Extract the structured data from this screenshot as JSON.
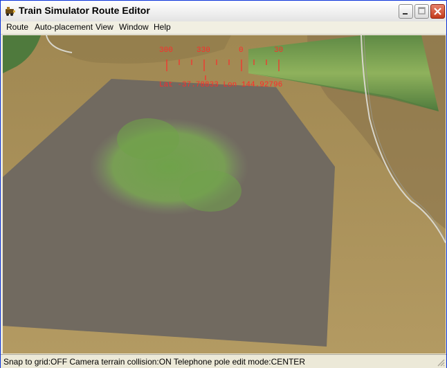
{
  "window": {
    "title": "Train Simulator Route Editor"
  },
  "menu": {
    "items": [
      {
        "label": "Route",
        "mnemonic": "R"
      },
      {
        "label": "Auto-placement",
        "mnemonic": "A"
      },
      {
        "label": "View",
        "mnemonic": "V"
      },
      {
        "label": "Window",
        "mnemonic": "W"
      },
      {
        "label": "Help",
        "mnemonic": "H"
      }
    ]
  },
  "compass": {
    "labels": [
      "300",
      "330",
      "0",
      "30"
    ],
    "coords": "Lat -37.78833 Lon 144.92796",
    "color": "#ff2a2a"
  },
  "status": {
    "text": "Snap to grid:OFF Camera terrain collision:ON Telephone pole edit mode:CENTER"
  }
}
